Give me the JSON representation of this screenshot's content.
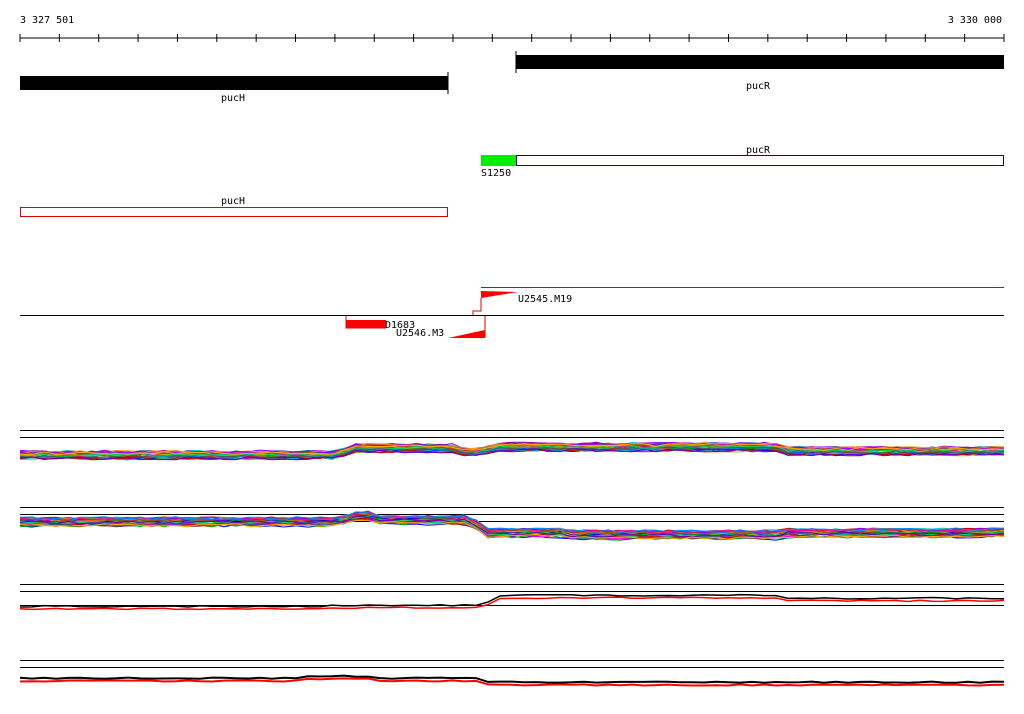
{
  "ruler": {
    "start_label": "3 327 501",
    "end_label": "3 330 000"
  },
  "genes": {
    "puch_top": "pucH",
    "pucr_top": "pucR",
    "pucr_cds": "pucR",
    "puch_cds": "pucH"
  },
  "features": {
    "s_label": "S1250",
    "d_label": "D1683",
    "u_plus_label": "U2545.M19",
    "u_minus_label": "U2546.M3"
  },
  "colors": {
    "gene_bar": "#000000",
    "forward_box": "#0000cc",
    "reverse_box": "#dd0000",
    "s_feature": "#00ee00",
    "marker": "#ff0000",
    "track_line": "#000000"
  }
}
